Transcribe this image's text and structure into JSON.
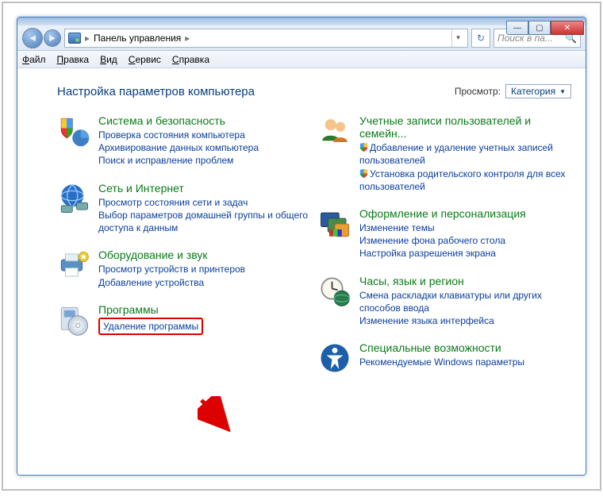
{
  "titlebar": {
    "breadcrumb_root": "Панель управления",
    "search_placeholder": "Поиск в па..."
  },
  "menubar": {
    "items": [
      "Файл",
      "Правка",
      "Вид",
      "Сервис",
      "Справка"
    ]
  },
  "content": {
    "heading": "Настройка параметров компьютера",
    "view_label": "Просмотр:",
    "view_value": "Категория"
  },
  "left_categories": [
    {
      "title": "Система и безопасность",
      "links": [
        "Проверка состояния компьютера",
        "Архивирование данных компьютера",
        "Поиск и исправление проблем"
      ]
    },
    {
      "title": "Сеть и Интернет",
      "links": [
        "Просмотр состояния сети и задач",
        "Выбор параметров домашней группы и общего доступа к данным"
      ]
    },
    {
      "title": "Оборудование и звук",
      "links": [
        "Просмотр устройств и принтеров",
        "Добавление устройства"
      ]
    },
    {
      "title": "Программы",
      "links": [
        "Удаление программы"
      ]
    }
  ],
  "right_categories": [
    {
      "title": "Учетные записи пользователей и семейн...",
      "links": [
        {
          "shield": true,
          "text": "Добавление и удаление учетных записей пользователей"
        },
        {
          "shield": true,
          "text": "Установка родительского контроля для всех пользователей"
        }
      ]
    },
    {
      "title": "Оформление и персонализация",
      "links": [
        "Изменение темы",
        "Изменение фона рабочего стола",
        "Настройка разрешения экрана"
      ]
    },
    {
      "title": "Часы, язык и регион",
      "links": [
        "Смена раскладки клавиатуры или других способов ввода",
        "Изменение языка интерфейса"
      ]
    },
    {
      "title": "Специальные возможности",
      "links": [
        "Рекомендуемые Windows параметры"
      ]
    }
  ]
}
